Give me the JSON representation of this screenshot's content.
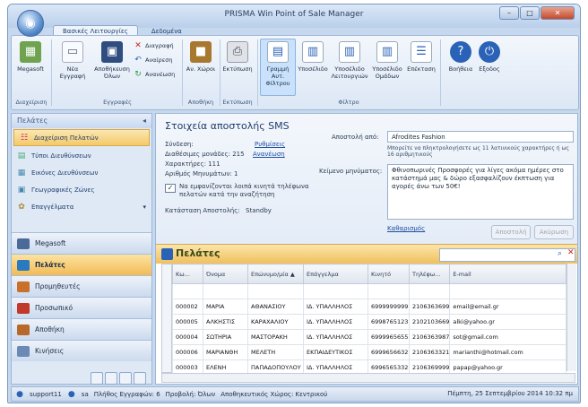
{
  "window": {
    "title": "PRISMA Win Point of Sale Manager",
    "minimize": "–",
    "maximize": "□",
    "close": "✕"
  },
  "tabs": [
    "Βασικές Λειτουργίες",
    "Δεδομένα"
  ],
  "ribbon": {
    "megasoft": "Megasoft",
    "new": "Νέα Εγγραφή",
    "save_all": "Αποθήκευση Όλων",
    "delete": "Διαγραφή",
    "undo": "Αναίρεση",
    "refresh": "Ανανέωση",
    "an_xwroi": "Αν. Χώροι",
    "print": "Εκτύπωση",
    "line_filter": "Γραμμή Αυτ. Φίλτρου",
    "hypokeimeno": "Υποσέλιδο",
    "hyp_leit": "Υποσέλιδο Λειτουργιών",
    "hyp_omad": "Υποσέλιδο Ομάδων",
    "extension": "Επέκταση",
    "help": "Βοήθεια",
    "exit": "Εξοδος",
    "groups": {
      "management": "Διαχείριση",
      "records": "Εγγραφές",
      "warehouse": "Αποθήκη",
      "print": "Εκτύπωση",
      "filter": "Φίλτρο"
    }
  },
  "sidebar": {
    "header": "Πελάτες",
    "items": [
      "Διαχείριση Πελατών",
      "Τύποι Διευθύνσεων",
      "Εικόνες Διευθύνσεων",
      "Γεωγραφικές Ζώνες",
      "Επαγγέλματα"
    ],
    "nav": [
      "Megasoft",
      "Πελάτες",
      "Προμηθευτές",
      "Προσωπικό",
      "Αποθήκη",
      "Κινήσεις"
    ]
  },
  "sms": {
    "title": "Στοιχεία αποστολής SMS",
    "connection_label": "Σύνδεση:",
    "settings_link": "Ρυθμίσεις",
    "units_label": "Διαθέσιμες μονάδες: 215",
    "refresh_link": "Ανανέωση",
    "chars_label": "Χαρακτήρες: 111",
    "count_label": "Αριθμός Μηνυμάτων: 1",
    "checkbox_label": "Να εμφανίζονται λοιπά κινητά τηλέφωνα πελατών κατά την αναζήτηση",
    "status_label": "Κατάσταση Αποστολής:",
    "status_value": "Standby",
    "sender_label": "Αποστολή από:",
    "sender_value": "Afrodites Fashion",
    "hint": "Μπορείτε να πληκτρολογήσετε ως 11 λατινικούς χαρακτήρες ή ως 16 αριθμητικούς",
    "message_label": "Κείμενο μηνύματος:",
    "message_value": "Φθινοπωρινές Προσφορές για λίγες ακόμα ημέρες στο κατάστημά μας & δώρο εξασφαλίζουν έκπτωση για αγορές άνω των 50€!",
    "clear_link": "Καθαρισμός",
    "send_btn": "Αποστολή",
    "cancel_btn": "Ακύρωση"
  },
  "grid": {
    "title": "Πελάτες",
    "columns": [
      "Κω...",
      "Όνομα",
      "Επώνυμο/μία ▲",
      "Επάγγελμα",
      "Κινητό",
      "Τηλέφω...",
      "E-mail"
    ],
    "rows": [
      [
        "000002",
        "ΜΑΡΙΑ",
        "ΑΘΑΝΑΣΙΟΥ",
        "ΙΔ. ΥΠΑΛΛΗΛΟΣ",
        "6999999999",
        "2106363699",
        "email@email.gr"
      ],
      [
        "000005",
        "ΑΛΚΗΣΤΙΣ",
        "ΚΑΡΑΧΑΛΙΟΥ",
        "ΙΔ. ΥΠΑΛΛΗΛΟΣ",
        "6998765123",
        "2102103669",
        "alki@yahoo.gr"
      ],
      [
        "000004",
        "ΣΩΤΗΡΙΑ",
        "ΜΑΣΤΟΡΑΚΗ",
        "ΙΔ. ΥΠΑΛΛΗΛΟΣ",
        "6999965655",
        "2106363987",
        "sot@gmail.com"
      ],
      [
        "000006",
        "ΜΑΡΙΑΝΘΗ",
        "ΜΕΛΕΤΗ",
        "ΕΚΠΑΙΔΕΥΤΙΚΟΣ",
        "6999656632",
        "2106363321",
        "marianthi@hotmail.com"
      ],
      [
        "000003",
        "ΕΛΕΝΗ",
        "ΠΑΠΑΔΟΠΟΥΛΟΥ",
        "ΙΔ. ΥΠΑΛΛΗΛΟΣ",
        "6996565332",
        "2106369999",
        "papap@yahoo.gr"
      ]
    ]
  },
  "status": {
    "user": "support11",
    "role": "sa",
    "records": "Πλήθος Εγγραφών: 6",
    "view": "Προβολή: Όλων",
    "warehouse": "Αποθηκευτικός Χώρος: Κεντρικού",
    "datetime": "Πέμπτη, 25 Σεπτεμβρίου 2014  10:32 πμ"
  }
}
